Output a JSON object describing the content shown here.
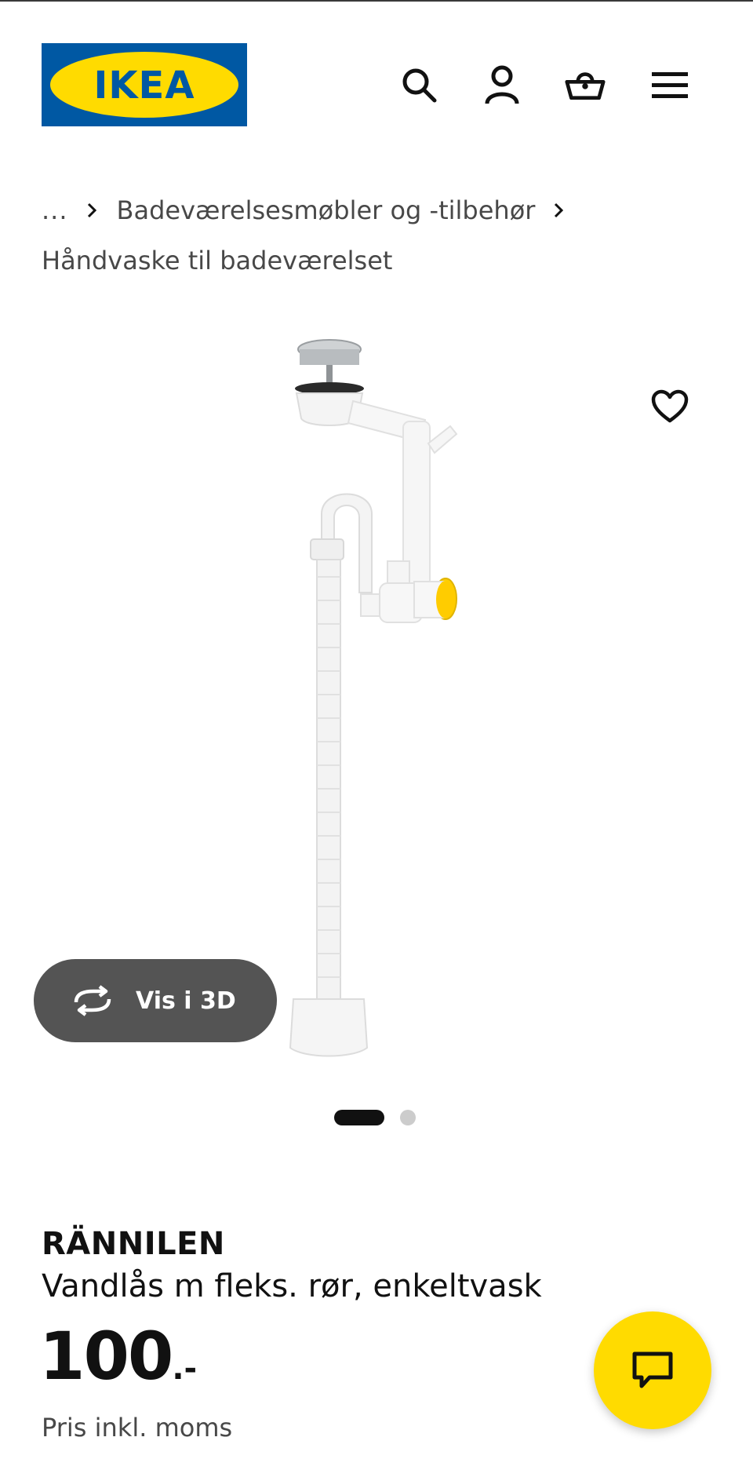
{
  "header": {
    "logo_text": "IKEA",
    "colors": {
      "logo_blue": "#0058a3",
      "logo_yellow": "#ffdb00"
    },
    "icons": [
      "search-icon",
      "account-icon",
      "basket-icon",
      "menu-icon"
    ]
  },
  "breadcrumb": {
    "ellipsis": "...",
    "items": [
      "Badeværelsesmøbler og -tilbehør",
      "Håndvaske til badeværelset"
    ]
  },
  "gallery": {
    "view_3d_label": "Vis i 3D",
    "total_images": 2,
    "active_index": 0
  },
  "product": {
    "name": "RÄNNILEN",
    "description": "Vandlås m fleks. rør, enkeltvask",
    "price_integer": "100",
    "price_decimal": ".-",
    "vat_note": "Pris inkl. moms"
  },
  "colors": {
    "accent_yellow": "#ffdb00",
    "button_gray": "#545454",
    "text": "#111111"
  }
}
